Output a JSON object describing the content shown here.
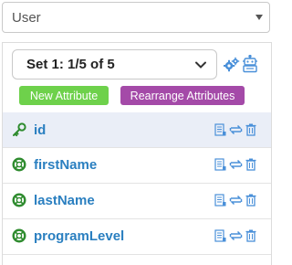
{
  "entity_select": {
    "value": "User"
  },
  "set_select": {
    "value": "Set 1: 1/5 of 5"
  },
  "toolbar": {
    "settings_icon": "gears-icon",
    "robot_icon": "robot-icon"
  },
  "buttons": {
    "new_attribute": "New Attribute",
    "rearrange_attributes": "Rearrange Attributes"
  },
  "attributes": [
    {
      "name": "id",
      "icon": "key-icon",
      "is_key": true
    },
    {
      "name": "firstName",
      "icon": "lifebuoy-icon",
      "is_key": false
    },
    {
      "name": "lastName",
      "icon": "lifebuoy-icon",
      "is_key": false
    },
    {
      "name": "programLevel",
      "icon": "lifebuoy-icon",
      "is_key": false
    }
  ],
  "row_actions": [
    "details-icon",
    "swap-icon",
    "trash-icon"
  ],
  "colors": {
    "accent_blue": "#2a7fc0",
    "icon_blue": "#4a90d9",
    "new_button": "#6ed14b",
    "rearrange_button": "#a44aa8",
    "key_icon": "#2e8b2e",
    "key_row_bg": "#eaeef7"
  }
}
